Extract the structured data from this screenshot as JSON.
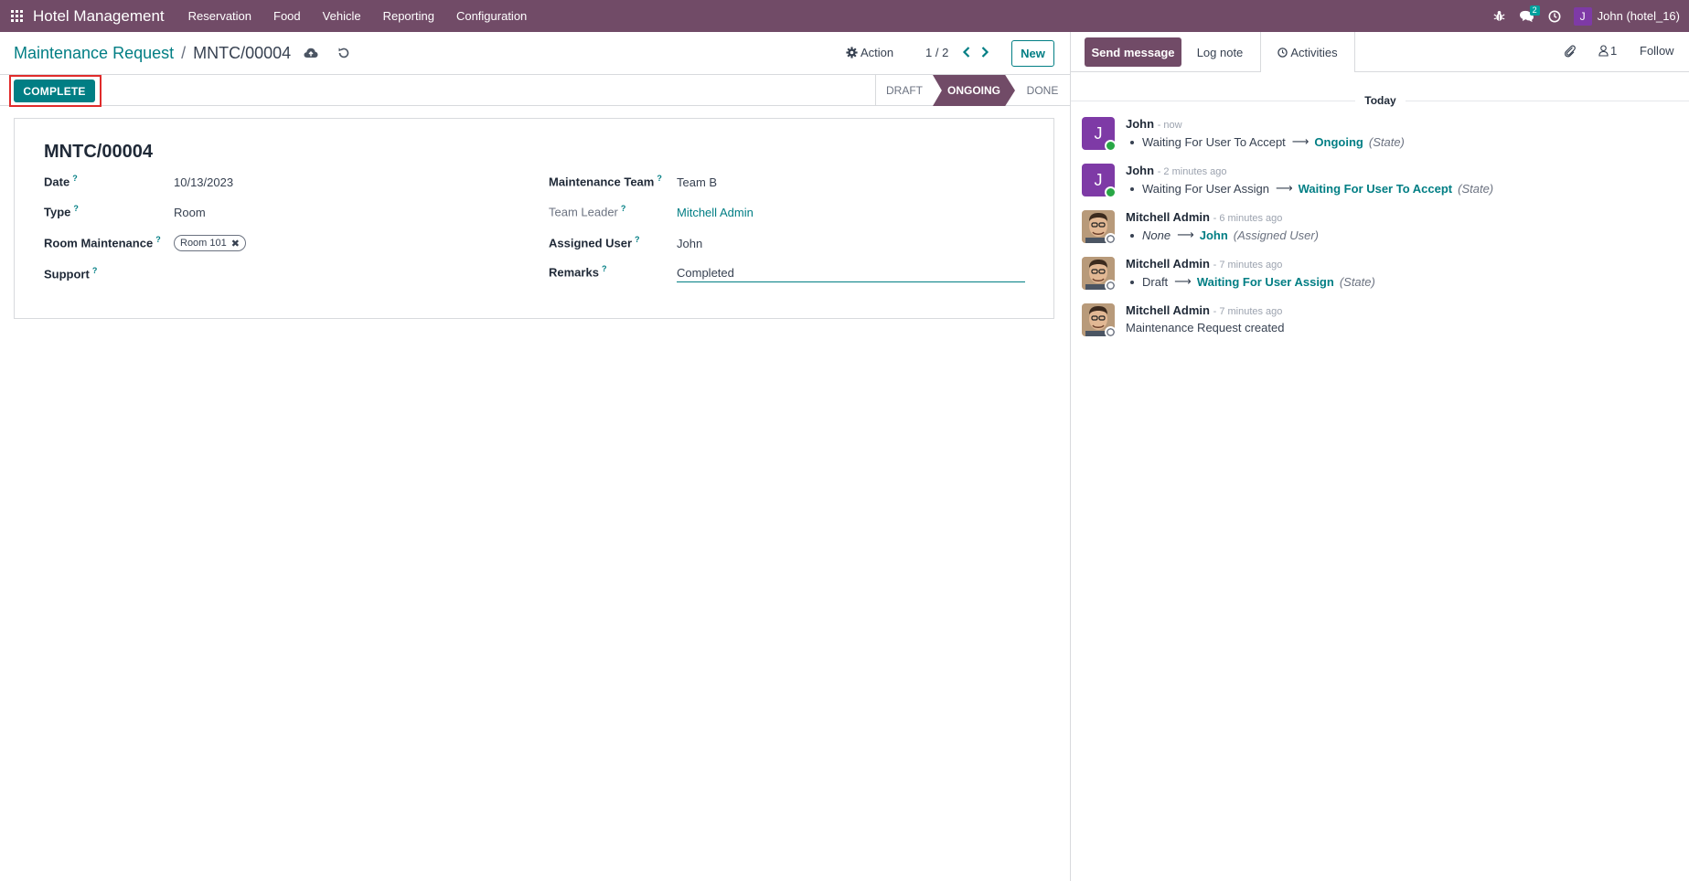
{
  "navbar": {
    "brand": "Hotel Management",
    "menu": [
      "Reservation",
      "Food",
      "Vehicle",
      "Reporting",
      "Configuration"
    ],
    "messages_badge": "2",
    "user_initial": "J",
    "user_name": "John (hotel_16)",
    "icons": [
      "apps-grid-icon",
      "bug-icon",
      "chat-icon",
      "clock-icon"
    ]
  },
  "control_panel": {
    "breadcrumb_parent": "Maintenance Request",
    "breadcrumb_sep": "/",
    "breadcrumb_current": "MNTC/00004",
    "action_label": "Action",
    "pager": "1 / 2",
    "new_label": "New"
  },
  "statusbar": {
    "complete_label": "COMPLETE",
    "stages": [
      "DRAFT",
      "ONGOING",
      "DONE"
    ],
    "active_stage": "ONGOING"
  },
  "form": {
    "record_name": "MNTC/00004",
    "help_mark": "?",
    "left": [
      {
        "label": "Date",
        "value": "10/13/2023"
      },
      {
        "label": "Type",
        "value": "Room"
      },
      {
        "label": "Room Maintenance",
        "tag": "Room 101"
      },
      {
        "label": "Support",
        "value": ""
      }
    ],
    "right": [
      {
        "label": "Maintenance Team",
        "value": "Team B"
      },
      {
        "label": "Team Leader",
        "value": "Mitchell Admin"
      },
      {
        "label": "Assigned User",
        "value": "John"
      },
      {
        "label": "Remarks",
        "value": "Completed"
      }
    ]
  },
  "chatter": {
    "send_message": "Send message",
    "log_note": "Log note",
    "activities": "Activities",
    "followers_count": "1",
    "follow": "Follow",
    "today": "Today",
    "messages": [
      {
        "author": "John",
        "date": "- now",
        "old": "Waiting For User To Accept",
        "new": "Ongoing",
        "field": "(State)"
      },
      {
        "author": "John",
        "date": "- 2 minutes ago",
        "old": "Waiting For User Assign",
        "new": "Waiting For User To Accept",
        "field": "(State)"
      },
      {
        "author": "Mitchell Admin",
        "date": "- 6 minutes ago",
        "old": "None",
        "new": "John",
        "field": "(Assigned User)"
      },
      {
        "author": "Mitchell Admin",
        "date": "- 7 minutes ago",
        "old": "Draft",
        "new": "Waiting For User Assign",
        "field": "(State)"
      },
      {
        "author": "Mitchell Admin",
        "date": "- 7 minutes ago",
        "text": "Maintenance Request created"
      }
    ],
    "arrow": "⟶"
  },
  "colors": {
    "brand": "#714b67",
    "accent": "#017e84",
    "highlight": "#e02b2b"
  }
}
